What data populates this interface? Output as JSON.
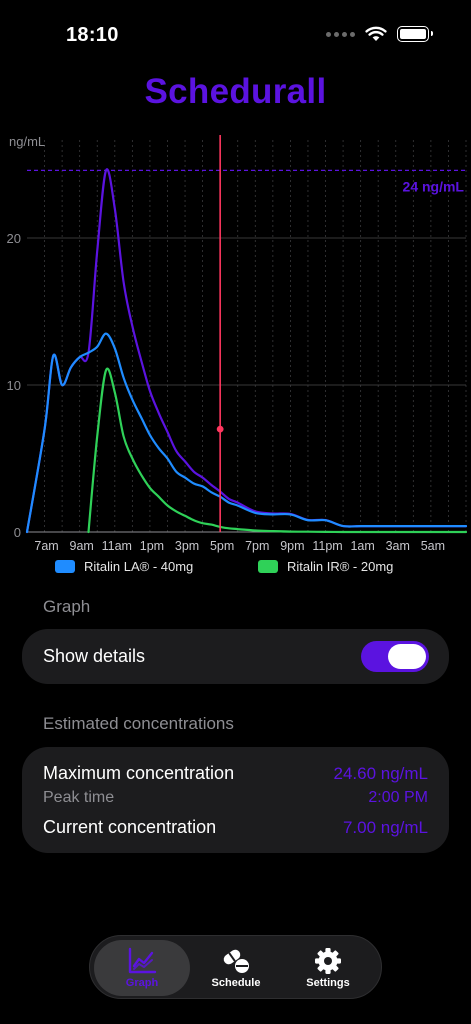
{
  "status_bar": {
    "time": "18:10"
  },
  "app": {
    "title": "Schedurall"
  },
  "chart_data": {
    "type": "line",
    "ylabel": "ng/mL",
    "ylim": [
      0,
      27
    ],
    "y_ticks": [
      0,
      10,
      20
    ],
    "x_tick_labels": [
      "7am",
      "9am",
      "11am",
      "1pm",
      "3pm",
      "5pm",
      "7pm",
      "9pm",
      "11pm",
      "1am",
      "3am",
      "5am"
    ],
    "x_hours": [
      6.0,
      7.0,
      7.5,
      8.0,
      8.5,
      9.0,
      9.5,
      10.0,
      10.5,
      11.0,
      11.5,
      12.0,
      12.5,
      13.0,
      13.5,
      14.0,
      14.5,
      15.0,
      15.5,
      16.0,
      16.5,
      17.0,
      17.5,
      18.0,
      19.0,
      20.0,
      21.0,
      22.0,
      23.0,
      24.0,
      25.0,
      26.0,
      27.0,
      28.0,
      29.0,
      30.0,
      31.0
    ],
    "max_line": {
      "value": 24.6,
      "label": "24 ng/mL"
    },
    "current": {
      "hour": 17.0,
      "value": 7.0
    },
    "series": [
      {
        "name": "Ritalin LA® - 40mg",
        "color": "#1f8cff",
        "values": [
          0,
          7.0,
          12.0,
          10.0,
          11.2,
          11.9,
          12.2,
          12.6,
          13.5,
          12.5,
          10.5,
          9.0,
          7.8,
          6.6,
          5.7,
          5.0,
          4.1,
          3.7,
          3.3,
          3.1,
          2.7,
          2.4,
          2.0,
          1.8,
          1.3,
          1.2,
          1.2,
          0.8,
          0.8,
          0.4,
          0.4,
          0.4,
          0.4,
          0.4,
          0.4,
          0.4,
          0.4
        ]
      },
      {
        "name": "Ritalin IR® - 20mg",
        "color": "#2fd158",
        "values": [
          null,
          null,
          null,
          null,
          null,
          null,
          0,
          6.5,
          11.0,
          9.5,
          6.5,
          5.0,
          3.9,
          3.0,
          2.4,
          1.8,
          1.4,
          1.1,
          0.8,
          0.6,
          0.5,
          0.35,
          0.25,
          0.2,
          0.1,
          0.06,
          0.03,
          0.02,
          0.01,
          0,
          0,
          0,
          0,
          0,
          0,
          0,
          0
        ]
      },
      {
        "name": "Total",
        "color": "#5b13e0",
        "values": [
          0,
          7.0,
          12.0,
          10.0,
          11.2,
          11.9,
          12.2,
          19.1,
          24.6,
          22.0,
          17.0,
          14.0,
          11.7,
          9.6,
          8.1,
          6.8,
          5.5,
          4.8,
          4.1,
          3.7,
          3.2,
          2.75,
          2.25,
          2.0,
          1.4,
          1.26,
          1.23,
          0.82,
          0.81,
          0.4,
          0.4,
          0.4,
          0.4,
          0.4,
          0.4,
          0.4,
          0.4
        ]
      }
    ]
  },
  "legend": [
    {
      "label": "Ritalin LA® - 40mg",
      "color": "#1f8cff"
    },
    {
      "label": "Ritalin IR® - 20mg",
      "color": "#2fd158"
    }
  ],
  "graph_section": {
    "title": "Graph",
    "show_details_label": "Show details",
    "show_details_on": true
  },
  "concentration_section": {
    "title": "Estimated concentrations",
    "max_label": "Maximum concentration",
    "max_value": "24.60 ng/mL",
    "peak_label": "Peak time",
    "peak_value": "2:00 PM",
    "current_label": "Current concentration",
    "current_value": "7.00 ng/mL"
  },
  "tabbar": {
    "tabs": [
      {
        "label": "Graph",
        "icon": "chart-icon",
        "active": true
      },
      {
        "label": "Schedule",
        "icon": "pills-icon",
        "active": false
      },
      {
        "label": "Settings",
        "icon": "gear-icon",
        "active": false
      }
    ]
  },
  "colors": {
    "accent": "#5b13e0",
    "current_marker": "#ff375f",
    "card": "#1c1c1e"
  }
}
